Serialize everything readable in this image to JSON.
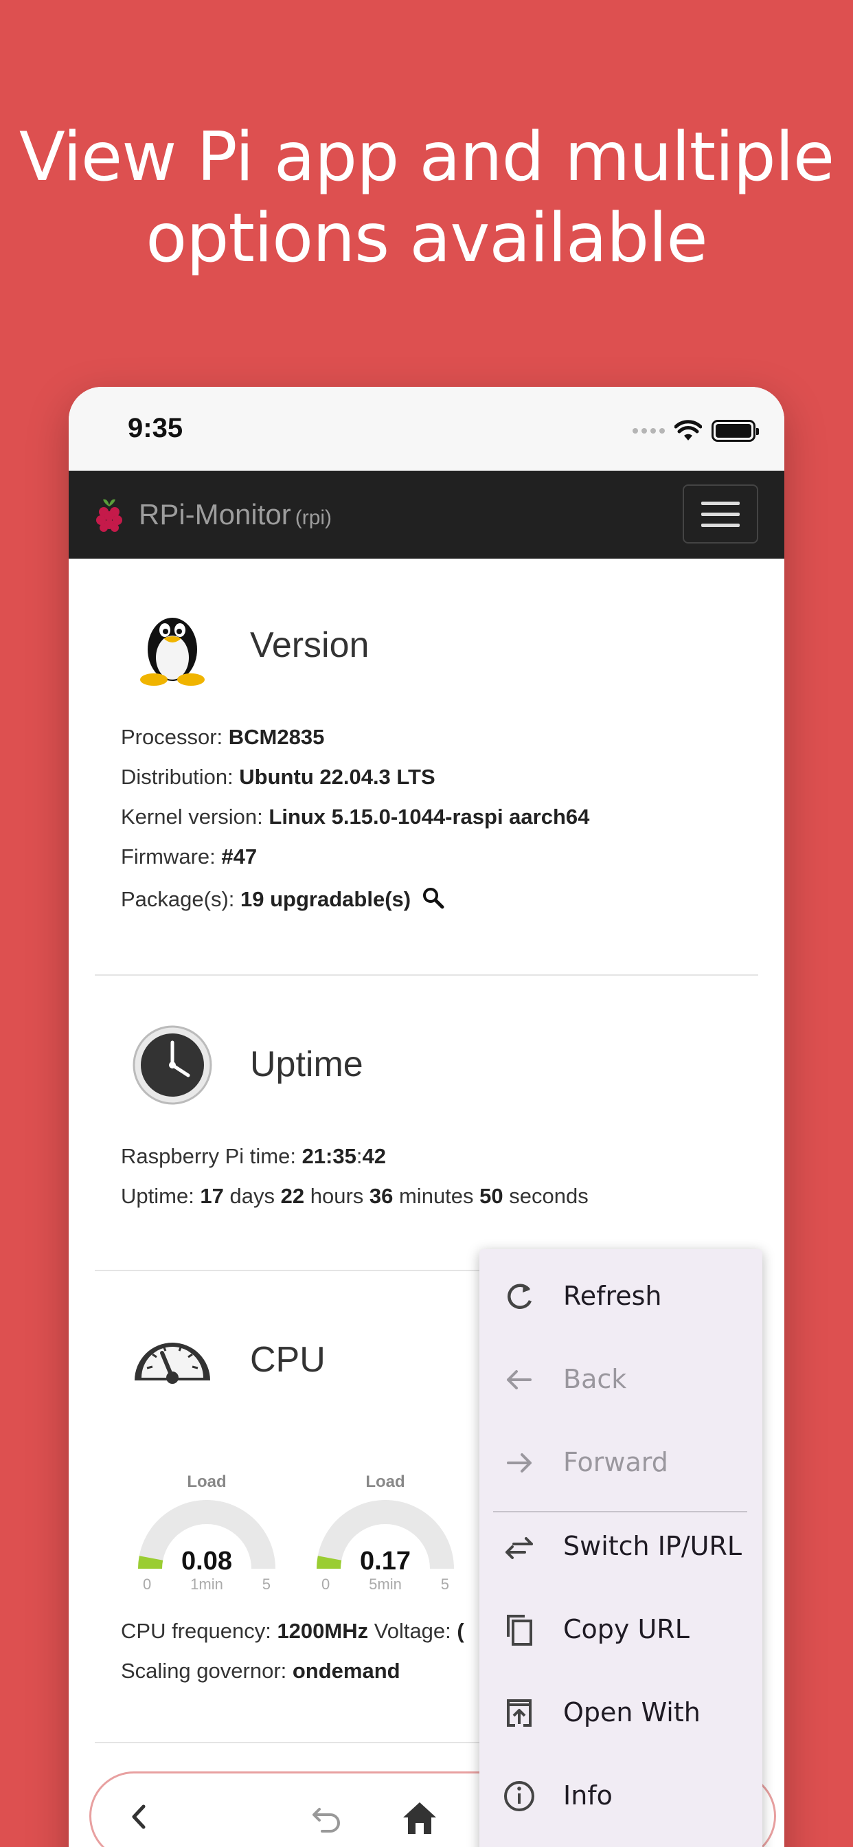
{
  "headline": "View Pi app and multiple options available",
  "status_bar": {
    "time": "9:35"
  },
  "navbar": {
    "brand": "RPi-Monitor",
    "host": "(rpi)"
  },
  "version": {
    "title": "Version",
    "processor_label": "Processor: ",
    "processor": "BCM2835",
    "distribution_label": "Distribution: ",
    "distribution": "Ubuntu 22.04.3 LTS",
    "kernel_label": "Kernel version: ",
    "kernel": "Linux 5.15.0-1044-raspi aarch64",
    "firmware_label": "Firmware: ",
    "firmware": "#47",
    "packages_label": "Package(s): ",
    "packages": "19 upgradable(s)"
  },
  "uptime": {
    "title": "Uptime",
    "pi_time_label": "Raspberry Pi time: ",
    "pi_time_hm": "21:35",
    "pi_time_colon": ":",
    "pi_time_s": "42",
    "uptime_label": "Uptime: ",
    "days": "17",
    "days_unit": " days ",
    "hours": "22",
    "hours_unit": " hours ",
    "minutes": "36",
    "minutes_unit": " minutes ",
    "seconds": "50",
    "seconds_unit": " seconds"
  },
  "cpu": {
    "title": "CPU",
    "gauges": [
      {
        "label": "Load",
        "value": "0.08",
        "min": "0",
        "max": "5",
        "sub": "1min",
        "level": 0.016
      },
      {
        "label": "Load",
        "value": "0.17",
        "min": "0",
        "max": "5",
        "sub": "5min",
        "level": 0.034
      }
    ],
    "freq_label": "CPU frequency: ",
    "freq": "1200MHz",
    "voltage_label": " Voltage: ",
    "voltage": "(",
    "governor_label": "Scaling governor: ",
    "governor": "ondemand",
    "gauge_fill_color": "#9acd32"
  },
  "menu": {
    "items": [
      {
        "label": "Refresh",
        "icon": "refresh-icon",
        "enabled": true
      },
      {
        "label": "Back",
        "icon": "arrow-left-icon",
        "enabled": false
      },
      {
        "label": "Forward",
        "icon": "arrow-right-icon",
        "enabled": false
      },
      {
        "label": "Switch IP/URL",
        "icon": "swap-icon",
        "enabled": true
      },
      {
        "label": "Copy URL",
        "icon": "copy-icon",
        "enabled": true
      },
      {
        "label": "Open With",
        "icon": "open-with-icon",
        "enabled": true
      },
      {
        "label": "Info",
        "icon": "info-icon",
        "enabled": true
      }
    ]
  },
  "colors": {
    "background": "#dd5050",
    "navbar": "#212121",
    "menu": "#f1ecf4"
  }
}
